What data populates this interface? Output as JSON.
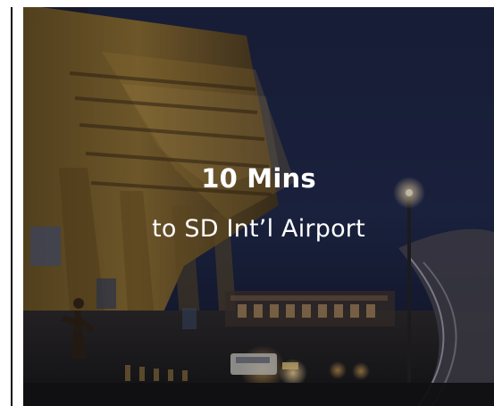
{
  "card": {
    "headline": "10 Mins",
    "subhead": "to SD Int’l Airport"
  },
  "palette": {
    "sky": "#1b2441",
    "night": "#0f1424",
    "gold": "#b5862c",
    "amber": "#ffce64",
    "white": "#ffffff"
  }
}
